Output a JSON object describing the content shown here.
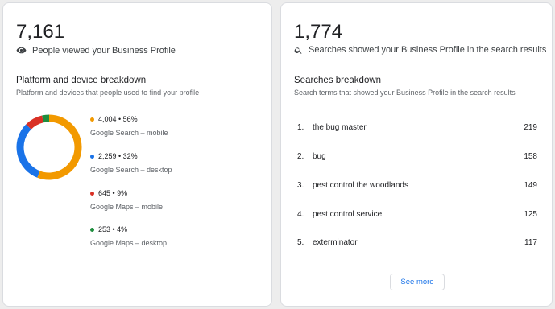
{
  "views": {
    "total": "7,161",
    "subtitle": "People viewed your Business Profile",
    "section_title": "Platform and device breakdown",
    "section_desc": "Platform and devices that people used to find your profile",
    "breakdown": [
      {
        "value_text": "4,004 • 56%",
        "label": "Google Search – mobile",
        "color": "#f29900",
        "value": 4004,
        "percent": 56
      },
      {
        "value_text": "2,259 • 32%",
        "label": "Google Search – desktop",
        "color": "#1a73e8",
        "value": 2259,
        "percent": 32
      },
      {
        "value_text": "645 • 9%",
        "label": "Google Maps – mobile",
        "color": "#d93025",
        "value": 645,
        "percent": 9
      },
      {
        "value_text": "253 • 4%",
        "label": "Google Maps – desktop",
        "color": "#1e8e3e",
        "value": 253,
        "percent": 4
      }
    ]
  },
  "searches": {
    "total": "1,774",
    "subtitle": "Searches showed your Business Profile in the search results",
    "section_title": "Searches breakdown",
    "section_desc": "Search terms that showed your Business Profile in the search results",
    "terms": [
      {
        "rank": "1.",
        "term": "the bug master",
        "count": "219"
      },
      {
        "rank": "2.",
        "term": "bug",
        "count": "158"
      },
      {
        "rank": "3.",
        "term": "pest control the woodlands",
        "count": "149"
      },
      {
        "rank": "4.",
        "term": "pest control service",
        "count": "125"
      },
      {
        "rank": "5.",
        "term": "exterminator",
        "count": "117"
      }
    ],
    "see_more_label": "See more"
  }
}
